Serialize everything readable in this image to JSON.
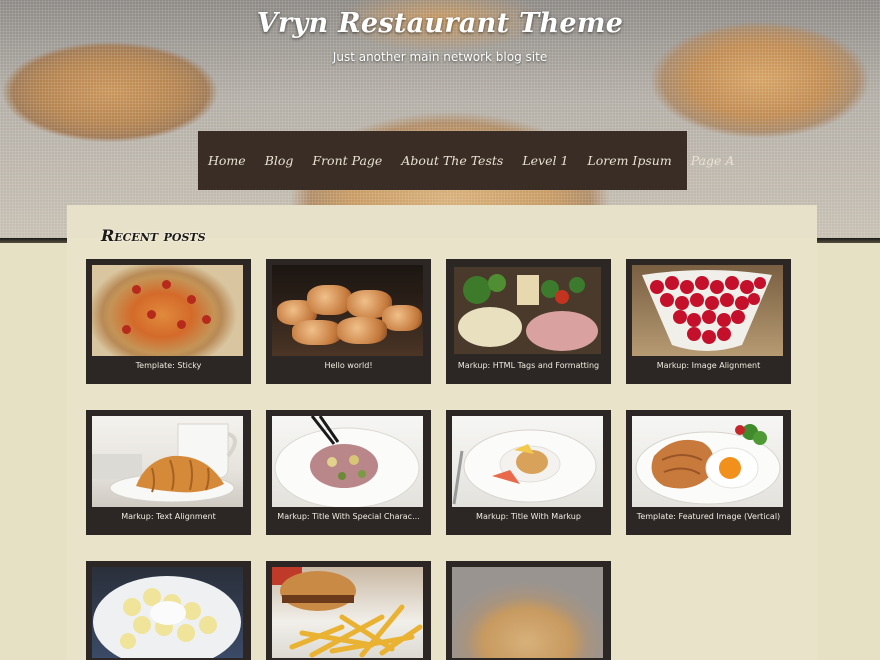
{
  "site": {
    "title": "Vryn Restaurant Theme",
    "description": "Just another main network blog site"
  },
  "nav": {
    "items": [
      "Home",
      "Blog",
      "Front Page",
      "About The Tests",
      "Level 1",
      "Lorem Ipsum",
      "Page A"
    ]
  },
  "recent_posts": {
    "heading": "Recent posts",
    "posts": [
      {
        "title": "Template: Sticky",
        "image": "pizza"
      },
      {
        "title": "Hello world!",
        "image": "grilled-pastries"
      },
      {
        "title": "Markup: HTML Tags and Formatting",
        "image": "antipasto-board"
      },
      {
        "title": "Markup: Image Alignment",
        "image": "raspberries"
      },
      {
        "title": "Markup: Text Alignment",
        "image": "croissant"
      },
      {
        "title": "Markup: Title With Special Charac...",
        "image": "pasta-plate"
      },
      {
        "title": "Markup: Title With Markup",
        "image": "risotto-plate"
      },
      {
        "title": "Template: Featured Image (Vertical)",
        "image": "chicken-egg"
      },
      {
        "title": "",
        "image": "potato-salad"
      },
      {
        "title": "",
        "image": "burger-fries"
      },
      {
        "title": "",
        "image": "muffin"
      }
    ]
  },
  "colors": {
    "nav_bg": "#3a2d25",
    "card_bg": "#2c2724",
    "page_bg": "#e6e0c5"
  }
}
